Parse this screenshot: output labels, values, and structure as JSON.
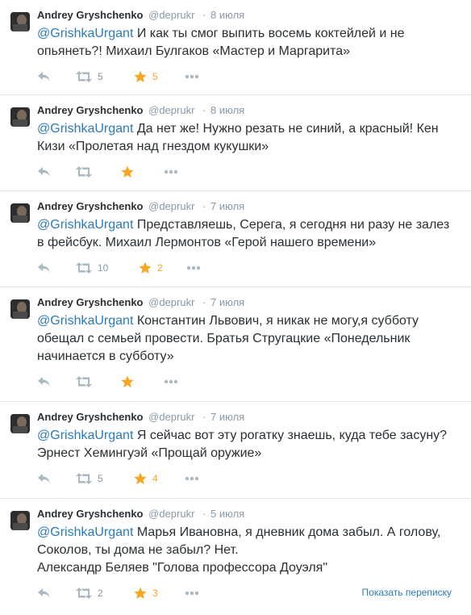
{
  "tweets": [
    {
      "name": "Andrey Gryshchenko",
      "handle": "@deprukr",
      "separator": "·",
      "time": "8 июля",
      "mention": "@GrishkaUrgant",
      "text": " И как ты смог выпить восемь коктейлей и не опьянеть?! Михаил Булгаков «Мастер и Маргарита»",
      "retweets": "5",
      "favorites": "5"
    },
    {
      "name": "Andrey Gryshchenko",
      "handle": "@deprukr",
      "separator": "·",
      "time": "8 июля",
      "mention": "@GrishkaUrgant",
      "text": " Да нет же! Нужно резать не синий, а красный! Кен Кизи «Пролетая над гнездом кукушки»",
      "retweets": "",
      "favorites": ""
    },
    {
      "name": "Andrey Gryshchenko",
      "handle": "@deprukr",
      "separator": "·",
      "time": "7 июля",
      "mention": "@GrishkaUrgant",
      "text": " Представляешь, Серега, я сегодня ни разу не залез в фейсбук. Михаил Лермонтов «Герой нашего времени»",
      "retweets": "10",
      "favorites": "2"
    },
    {
      "name": "Andrey Gryshchenko",
      "handle": "@deprukr",
      "separator": "·",
      "time": "7 июля",
      "mention": "@GrishkaUrgant",
      "text": " Константин Львович, я никак не могу,я субботу обещал с семьей провести. Братья Стругацкие «Понедельник начинается в субботу»",
      "retweets": "",
      "favorites": ""
    },
    {
      "name": "Andrey Gryshchenko",
      "handle": "@deprukr",
      "separator": "·",
      "time": "7 июля",
      "mention": "@GrishkaUrgant",
      "text": " Я сейчас вот эту рогатку знаешь, куда тебе засуну? Эрнест Хемингуэй «Прощай оружие»",
      "retweets": "5",
      "favorites": "4"
    },
    {
      "name": "Andrey Gryshchenko",
      "handle": "@deprukr",
      "separator": "·",
      "time": "5 июля",
      "mention": "@GrishkaUrgant",
      "text": " Марья Ивановна, я дневник дома забыл. А голову, Соколов, ты дома не забыл? Нет.\nАлександр Беляев \"Голова профессора Доуэля\"",
      "retweets": "2",
      "favorites": "3"
    }
  ],
  "conversation_link": "Показать переписку",
  "icons": {
    "reply": "reply-arrow-icon",
    "retweet": "retweet-icon",
    "favorite": "star-icon",
    "more": "more-dots-icon"
  },
  "colors": {
    "link": "#2b7bb9",
    "muted": "#8899a6",
    "favorite": "#f6a623",
    "divider": "#e1e8ed"
  }
}
